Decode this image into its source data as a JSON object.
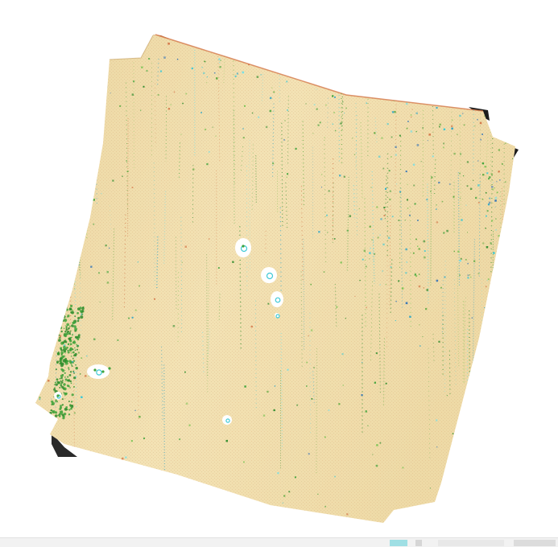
{
  "map": {
    "style": "orthomosaic point-cloud raster",
    "colors": {
      "background": "#ffffff",
      "ground_base": "#f1dfae",
      "ground_shadow": "#d8bf86",
      "orange_edge": "#d4784a",
      "vegetation": [
        "#3fa33a",
        "#2e8c2c",
        "#7dc456",
        "#5aa83d"
      ],
      "cyan_points": [
        "#3ec9d6",
        "#2aa4c8",
        "#77e0e6"
      ],
      "blue_points": "#2a6fb8",
      "dark_edge": "#1c1c1c",
      "hole": "#ffffff"
    },
    "icons": [
      "hole-marker-icon"
    ]
  },
  "status_bar": {
    "items": [
      {
        "name": "status-swatch-cyan",
        "color": "#9fdfe4"
      },
      {
        "name": "status-swatch-small",
        "color": "#d6d6d6"
      },
      {
        "name": "status-swatch-light",
        "color": "#e8e8e8"
      },
      {
        "name": "status-swatch-grey",
        "color": "#cccccc"
      }
    ]
  }
}
